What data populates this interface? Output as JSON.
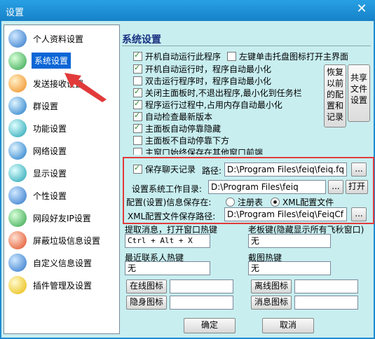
{
  "window": {
    "title": "设置"
  },
  "sidebar": {
    "items": [
      {
        "label": "个人资料设置",
        "icon": "user-profile-icon"
      },
      {
        "label": "系统设置",
        "icon": "system-settings-icon"
      },
      {
        "label": "发送接收设置",
        "icon": "send-receive-icon"
      },
      {
        "label": "群设置",
        "icon": "group-globe-icon"
      },
      {
        "label": "功能设置",
        "icon": "function-icon"
      },
      {
        "label": "网络设置",
        "icon": "network-icon"
      },
      {
        "label": "显示设置",
        "icon": "display-icon"
      },
      {
        "label": "个性设置",
        "icon": "personal-icon"
      },
      {
        "label": "网段好友IP设置",
        "icon": "ip-segment-icon"
      },
      {
        "label": "屏蔽垃圾信息设置",
        "icon": "spam-block-icon"
      },
      {
        "label": "自定义信息设置",
        "icon": "custom-info-icon"
      },
      {
        "label": "插件管理及设置",
        "icon": "plugin-icon"
      }
    ],
    "selected": "系统设置"
  },
  "panel": {
    "title": "系统设置",
    "checkboxes": [
      {
        "label": "开机自动运行此程序",
        "checked": true
      },
      {
        "label": "左键单击托盘图标打开主界面",
        "checked": false
      },
      {
        "label": "开机自动运行时，程序自动最小化",
        "checked": true
      },
      {
        "label": "双击运行程序时，程序自动最小化",
        "checked": false
      },
      {
        "label": "关闭主面板时,不退出程序,最小化到任务栏",
        "checked": true
      },
      {
        "label": "程序运行过程中,占用内存自动最小化",
        "checked": true
      },
      {
        "label": "自动检查最新版本",
        "checked": true
      },
      {
        "label": "主面板自动停靠隐藏",
        "checked": true
      },
      {
        "label": "主面板不自动停靠下方",
        "checked": false
      },
      {
        "label": "主窗口始终保存在其他窗口前端",
        "checked": false
      }
    ],
    "restore_button": "恢复以前的配置和记录",
    "share_button": "共享文件设置",
    "save_chat": {
      "label": "保存聊天记录",
      "checked": true,
      "path_label": "路径:",
      "path_value": "D:\\Program Files\\feiq\\feiq.fq",
      "browse": "..."
    },
    "workdir": {
      "label": "设置系统工作目录:",
      "value": "D:\\Program Files\\feiq",
      "browse": "...",
      "open": "打开"
    },
    "config_save": {
      "label": "配置(设置)信息保存在:",
      "option_registry": "注册表",
      "option_xml": "XML配置文件",
      "selected": "XML配置文件"
    },
    "xml_path": {
      "label": "XML配置文件保存路径:",
      "value": "D:\\Program Files\\feiq\\FeiqCf",
      "browse": "..."
    },
    "hotkeys": {
      "extract_label": "提取消息，打开窗口热键",
      "extract_value": "Ctrl + Alt + X",
      "boss_label": "老板键(隐藏显示所有飞秋窗口)",
      "boss_value": "无",
      "recent_label": "最近联系人热键",
      "recent_value": "无",
      "screenshot_label": "截图热键",
      "screenshot_value": "无"
    },
    "icons": {
      "online_button": "在线图标",
      "offline_button": "离线图标",
      "invisible_button": "隐身图标",
      "message_button": "消息图标"
    },
    "ok_button": "确定",
    "cancel_button": "取消"
  }
}
